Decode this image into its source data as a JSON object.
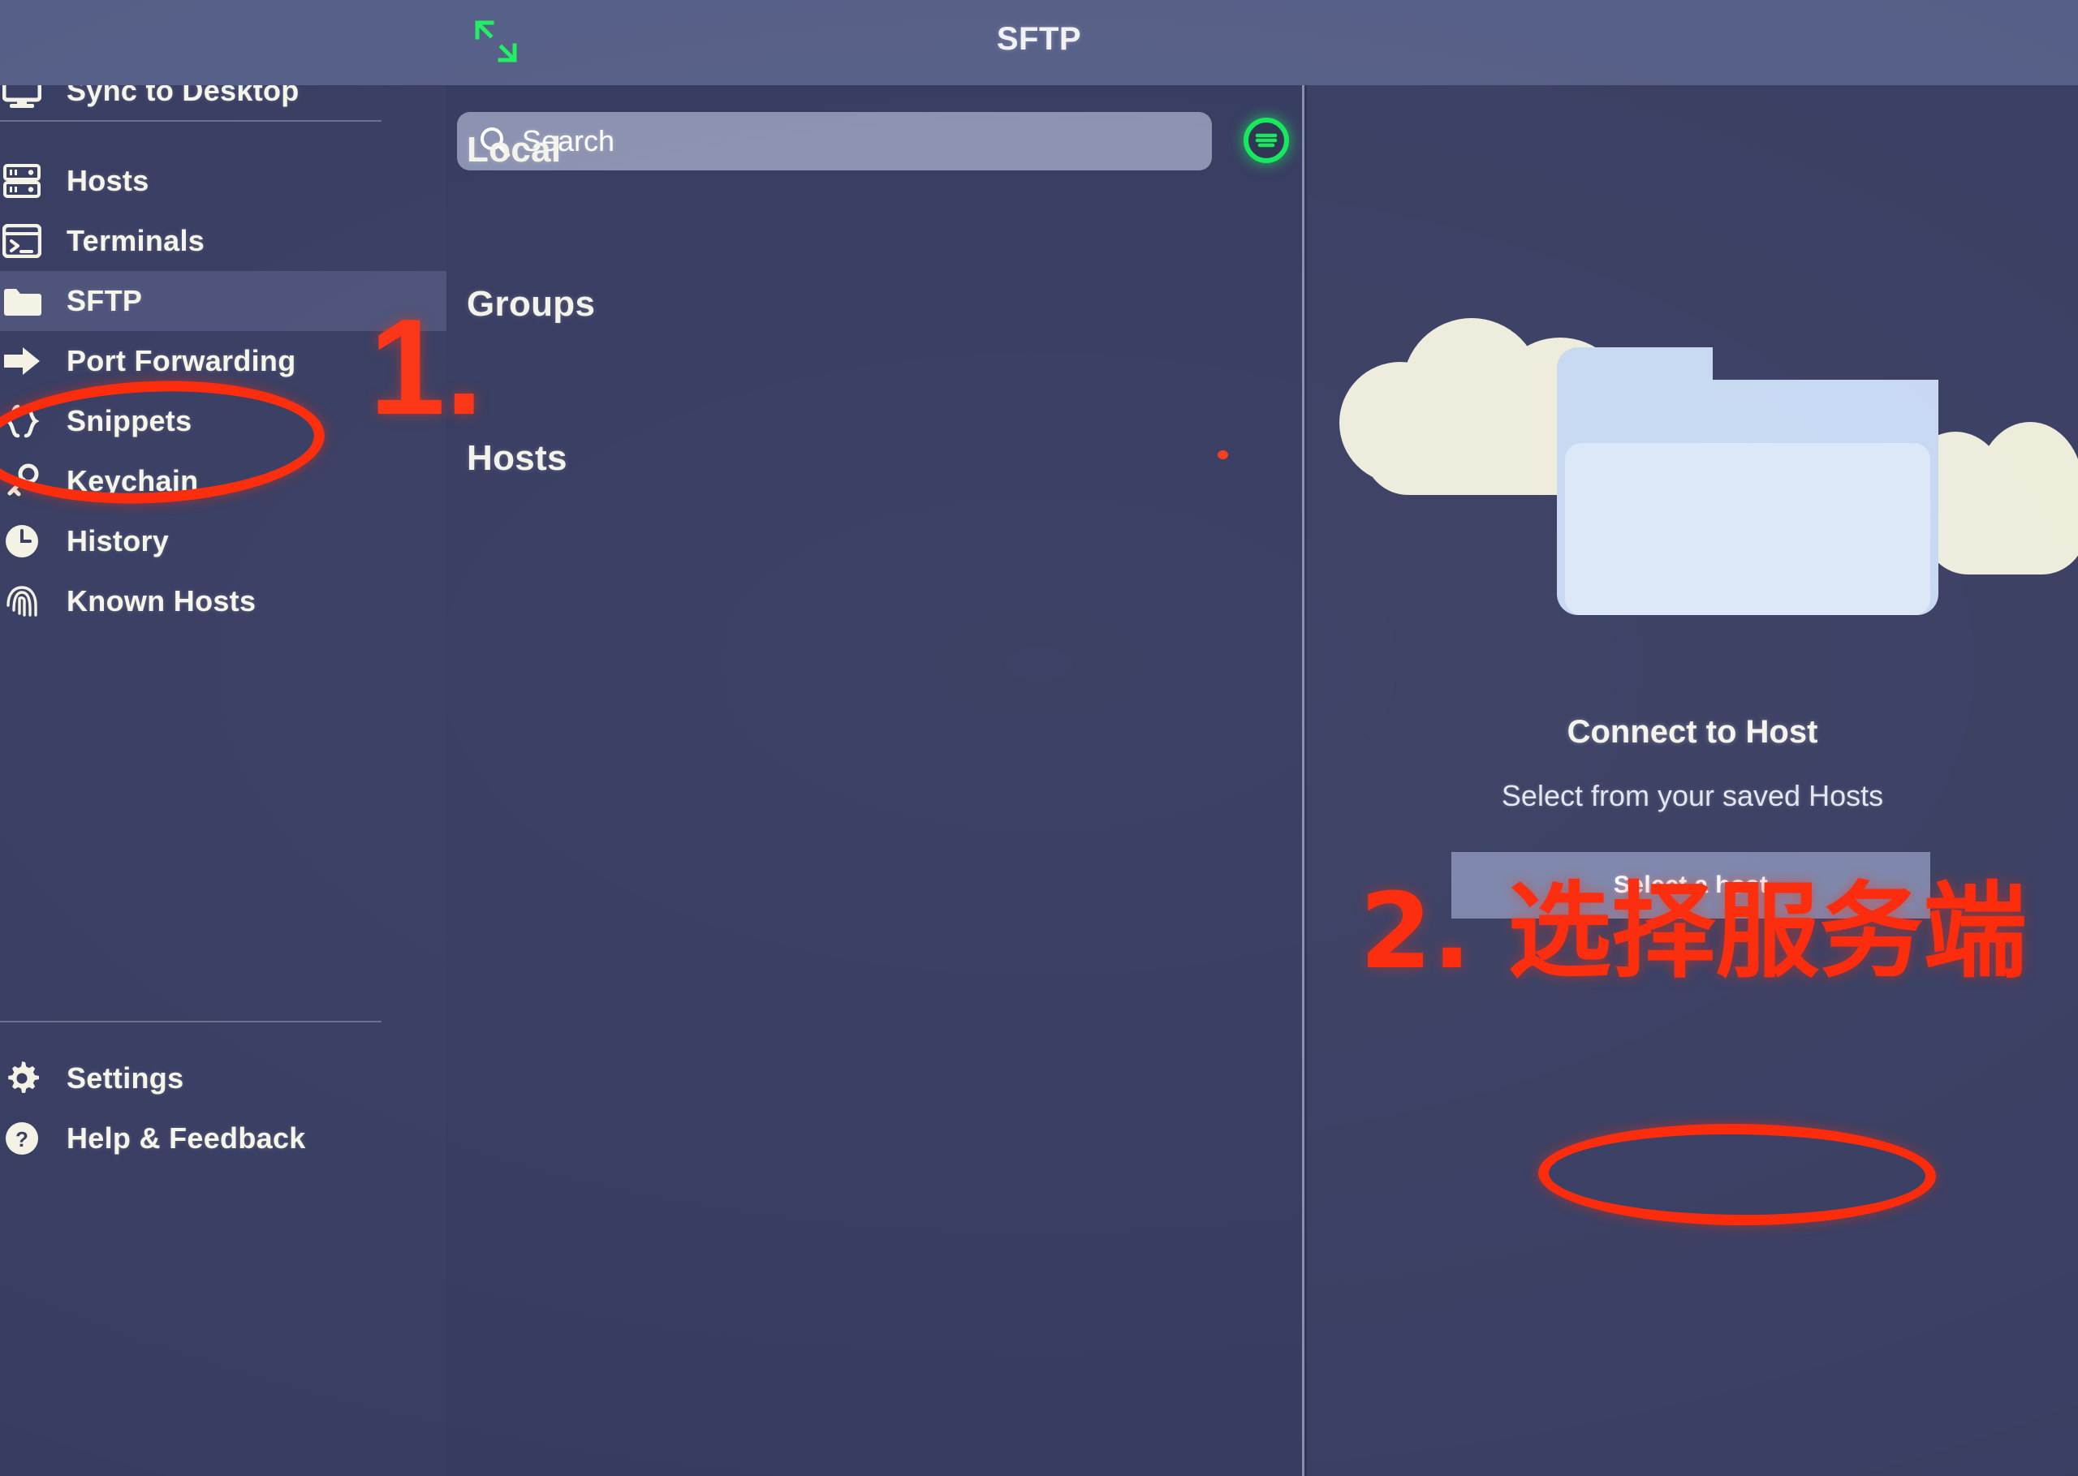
{
  "app": {
    "title": "SFTP",
    "accent_green": "#16e85c",
    "accent_red": "#fb2a0a",
    "sidebar_bg": "#383d62",
    "panel_bg": "#363b60",
    "right_panel_bg": "#3a3f63",
    "topbar_bg": "#565f87"
  },
  "topbar": {
    "title": "SFTP",
    "resize_icon": "expand-diagonal-icon"
  },
  "sidebar": {
    "sync": {
      "label": "Sync to Desktop",
      "icon": "monitor-icon",
      "badge_icon": "arrow-up-icon"
    },
    "items": [
      {
        "label": "Hosts",
        "icon": "server-rack-icon",
        "active": false
      },
      {
        "label": "Terminals",
        "icon": "terminal-icon",
        "active": false
      },
      {
        "label": "SFTP",
        "icon": "folder-icon",
        "active": true
      },
      {
        "label": "Port Forwarding",
        "icon": "forward-arrow-icon",
        "active": false
      },
      {
        "label": "Snippets",
        "icon": "curly-braces-icon",
        "active": false
      },
      {
        "label": "Keychain",
        "icon": "key-icon",
        "active": false
      },
      {
        "label": "History",
        "icon": "clock-icon",
        "active": false
      },
      {
        "label": "Known Hosts",
        "icon": "fingerprint-icon",
        "active": false
      }
    ],
    "footer_items": [
      {
        "label": "Settings",
        "icon": "gear-icon"
      },
      {
        "label": "Help & Feedback",
        "icon": "question-circle-icon"
      }
    ]
  },
  "search": {
    "placeholder": "Search",
    "value": "",
    "icon": "search-icon",
    "filter_icon": "filter-lines-icon"
  },
  "middle_panel": {
    "sections": [
      {
        "label": "Local",
        "items": []
      },
      {
        "label": "Groups",
        "items": []
      },
      {
        "label": "Hosts",
        "items": []
      }
    ]
  },
  "right_panel": {
    "illustration": "folder-in-clouds-illustration",
    "heading": "Connect to Host",
    "subtext": "Select from your saved Hosts",
    "button_label": "Select a host"
  },
  "annotations": [
    {
      "id": "step-1",
      "text": "1.",
      "kind": "number",
      "color": "#fc3314"
    },
    {
      "id": "step-1-circle",
      "text": "",
      "kind": "ellipse",
      "color": "#fb2a0a",
      "targets": "sidebar-item-sftp"
    },
    {
      "id": "step-2",
      "text": "2. 选择服务端",
      "kind": "number-text",
      "color": "#fb2a0a"
    },
    {
      "id": "step-2-circle",
      "text": "",
      "kind": "ellipse",
      "color": "#fb2a0a",
      "targets": "select-host-button"
    }
  ]
}
